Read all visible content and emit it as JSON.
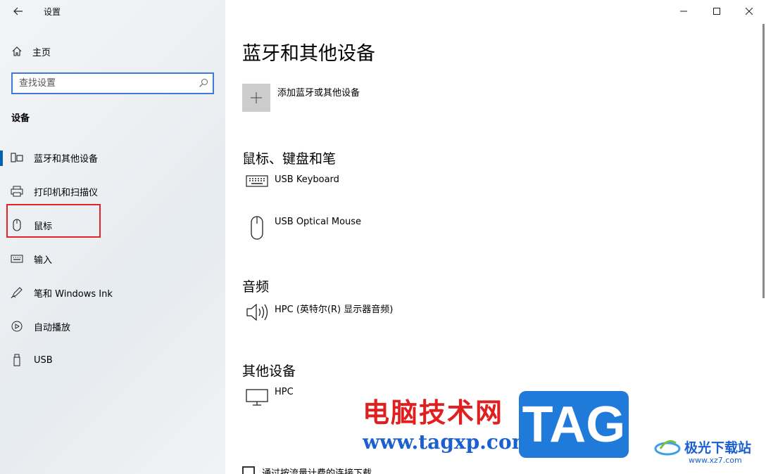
{
  "window": {
    "title": "设置"
  },
  "sidebar": {
    "home_label": "主页",
    "search_placeholder": "查找设置",
    "group_label": "设备",
    "items": [
      {
        "label": "蓝牙和其他设备",
        "icon": "bluetooth-devices-icon",
        "active": true
      },
      {
        "label": "打印机和扫描仪",
        "icon": "printer-icon"
      },
      {
        "label": "鼠标",
        "icon": "mouse-icon"
      },
      {
        "label": "输入",
        "icon": "keyboard-icon"
      },
      {
        "label": "笔和 Windows Ink",
        "icon": "pen-icon"
      },
      {
        "label": "自动播放",
        "icon": "autoplay-icon"
      },
      {
        "label": "USB",
        "icon": "usb-icon"
      }
    ]
  },
  "main": {
    "title": "蓝牙和其他设备",
    "add_label": "添加蓝牙或其他设备",
    "sections": [
      {
        "title": "鼠标、键盘和笔",
        "devices": [
          {
            "name": "USB Keyboard",
            "icon": "keyboard-icon"
          },
          {
            "name": "USB Optical Mouse",
            "icon": "mouse-icon"
          }
        ]
      },
      {
        "title": "音频",
        "devices": [
          {
            "name": "HPC (英特尔(R) 显示器音频)",
            "icon": "speaker-icon"
          }
        ]
      },
      {
        "title": "其他设备",
        "devices": [
          {
            "name": "HPC",
            "icon": "monitor-icon"
          }
        ]
      }
    ],
    "metered_label": "通过按流量计费的连接下载"
  },
  "watermark": {
    "cn_text": "电脑技术网",
    "url": "www.tagxp.com",
    "tag": "TAG",
    "logo_text": "极光下载站",
    "logo_url": "www.xz7.com"
  },
  "colors": {
    "accent": "#0063b1",
    "highlight": "#e0242a",
    "search_border": "#3e7bd6"
  }
}
